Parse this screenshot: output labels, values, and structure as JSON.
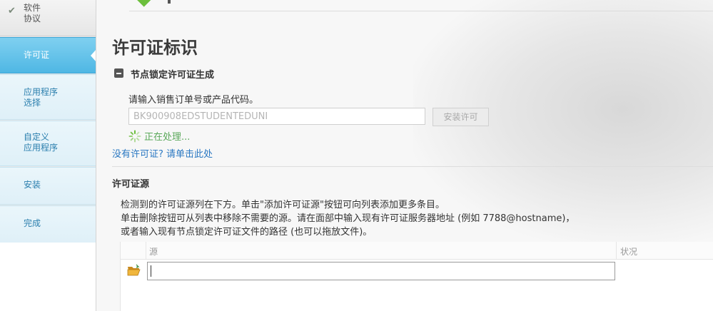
{
  "sidebar": {
    "top_item": {
      "label": "软件\n协议",
      "state": "completed"
    },
    "items": [
      {
        "label": "许可证",
        "active": true
      },
      {
        "label": "应用程序\n选择",
        "active": false
      },
      {
        "label": "自定义\n应用程序",
        "active": false
      },
      {
        "label": "安装",
        "active": false
      },
      {
        "label": "完成",
        "active": false
      }
    ]
  },
  "main": {
    "title": "许可证标识",
    "node_locked": {
      "heading": "节点锁定许可证生成",
      "prompt": "请输入销售订单号或产品代码。",
      "input_value": "BK900908EDSTUDENTEDUNI",
      "install_button": "安装许可",
      "status": "正在处理...",
      "no_license_link": "没有许可证? 请单击此处"
    },
    "license_source": {
      "heading": "许可证源",
      "description": [
        "检测到的许可证源列在下方。单击\"添加许可证源\"按钮可向列表添加更多条目。",
        "单击删除按钮可从列表中移除不需要的源。请在面部中输入现有许可证服务器地址 (例如 7788@hostname)，",
        "或者输入现有节点锁定许可证文件的路径 (也可以拖放文件)。"
      ],
      "table": {
        "columns": [
          "源",
          "状况"
        ],
        "row_value": ""
      }
    }
  },
  "colors": {
    "accent_active": "#4fb7e4",
    "sidebar_text": "#2b7fae",
    "link": "#2b78c2",
    "processing": "#5aa85a",
    "logo_green": "#6cbf3c"
  },
  "icons": [
    "check-icon",
    "collapse-minus-icon",
    "spinner-icon",
    "folder-open-icon"
  ]
}
